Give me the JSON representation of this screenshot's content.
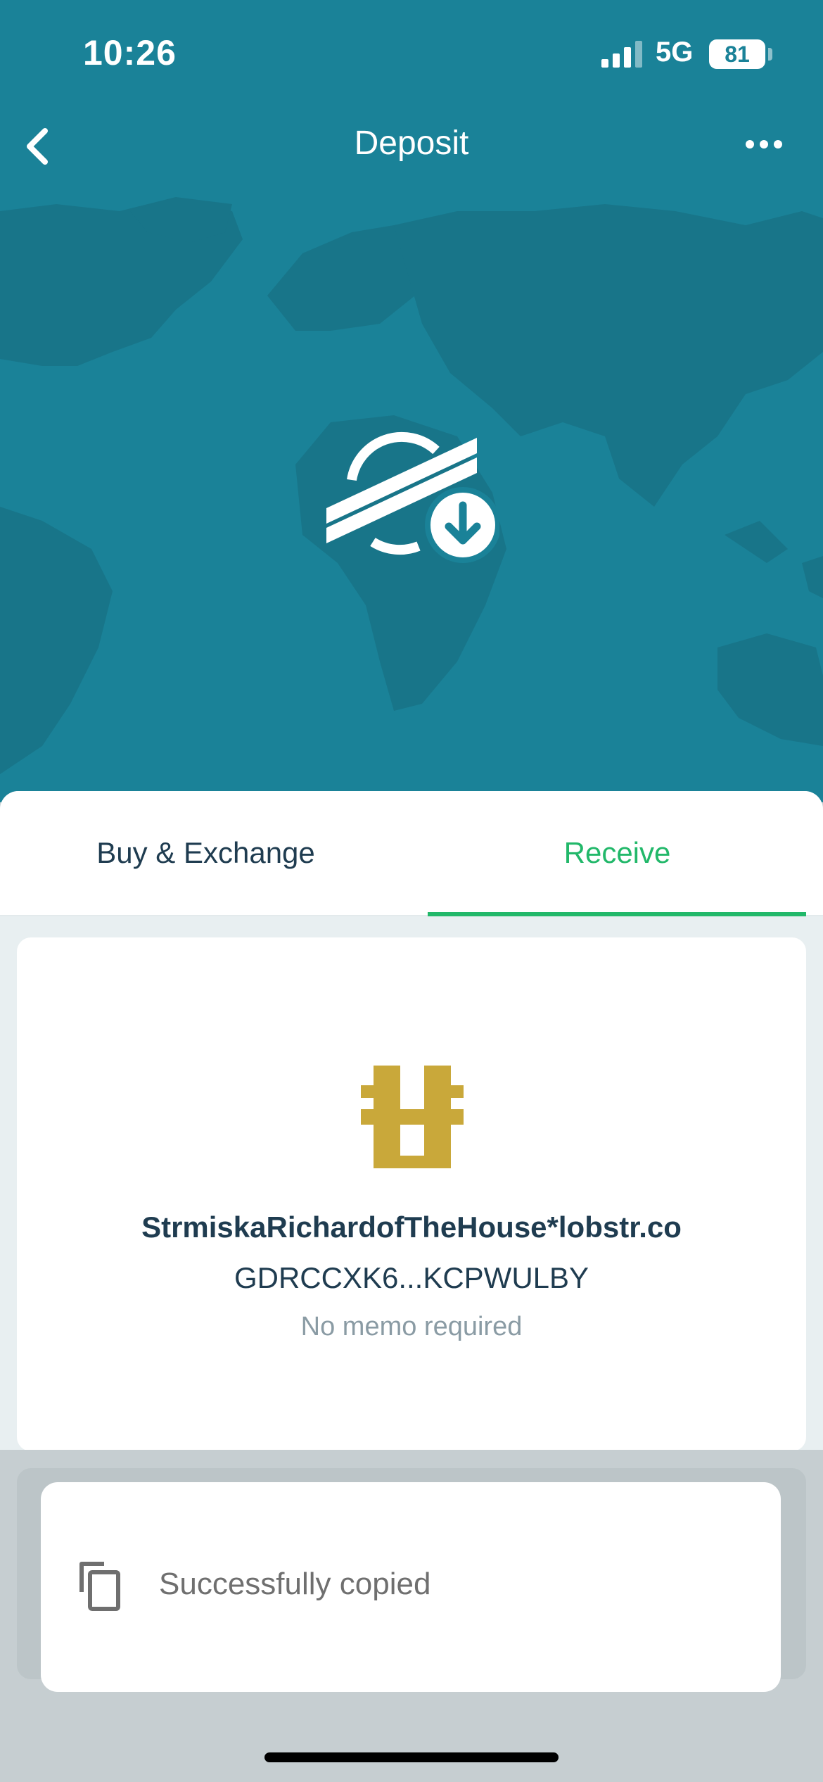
{
  "status_bar": {
    "time": "10:26",
    "network": "5G",
    "battery": "81"
  },
  "nav": {
    "title": "Deposit",
    "back_icon": "chevron-left-icon",
    "more_icon": "ellipsis-icon"
  },
  "hero": {
    "icon": "stellar-deposit-icon",
    "background_color": "#1a8298"
  },
  "tabs": [
    {
      "label": "Buy & Exchange",
      "active": false
    },
    {
      "label": "Receive",
      "active": true
    }
  ],
  "receive": {
    "identicon_color": "#c9a83a",
    "federation_address": "StrmiskaRichardofTheHouse*lobstr.co",
    "public_key": "GDRCCXK6...KCPWULBY",
    "memo_text": "No memo required"
  },
  "toast": {
    "icon": "copy-icon",
    "message": "Successfully copied"
  },
  "colors": {
    "accent": "#22b86a",
    "text_dark": "#1f3c50",
    "text_muted": "#8a9ba4"
  }
}
